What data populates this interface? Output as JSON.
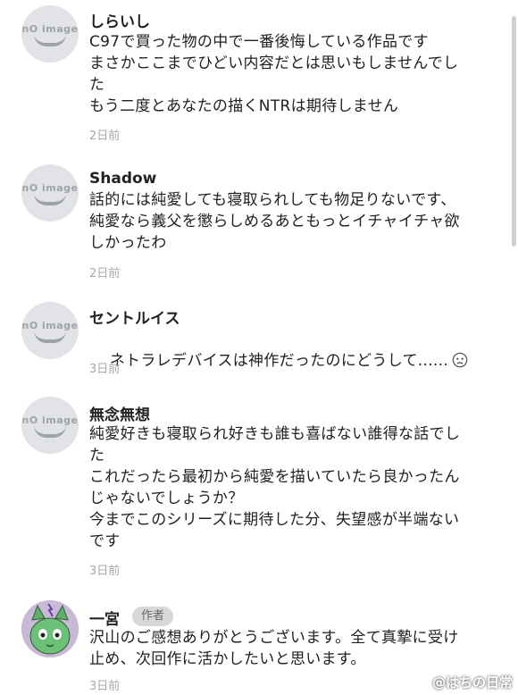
{
  "comments": [
    {
      "username": "しらいし",
      "avatar_text": "nO image",
      "lines": "C97で買った物の中で一番後悔している作品です\nまさかここまでひどい内容だとは思いもしませんでし\nた\nもう二度とあなたの描くNTRは期待しません",
      "time": "2日前"
    },
    {
      "username": "Shadow",
      "avatar_text": "nO image",
      "lines": "話的には純愛しても寝取られしても物足りないです、\n純愛なら義父を懲らしめるあともっとイチャイチャ欲\nしかったわ",
      "time": "2日前"
    },
    {
      "username": "セントルイス",
      "avatar_text": "nO image",
      "lines": "ネトラレデバイスは神作だったのにどうして......",
      "time": "3日前"
    },
    {
      "username": "無念無想",
      "avatar_text": "nO image",
      "lines": "純愛好きも寝取られ好きも誰も喜ばない誰得な話でし\nた\nこれだったら最初から純愛を描いていたら良かったん\nじゃないでしょうか？\n今までこのシリーズに期待した分、失望感が半端ない\nです",
      "time": "3日前"
    },
    {
      "username": "一宮",
      "badge": "作者",
      "lines": "沢山のご感想ありがとうございます。全て真摯に受け\n止め、次回作に活かしたいと思います。",
      "time": "3日前"
    }
  ],
  "watermark": "@はちの日常",
  "icons": {
    "default_avatar": "no-image-avatar-icon",
    "author_avatar": "cat-avatar-icon",
    "emoji": "sad-face-emoji-icon"
  }
}
